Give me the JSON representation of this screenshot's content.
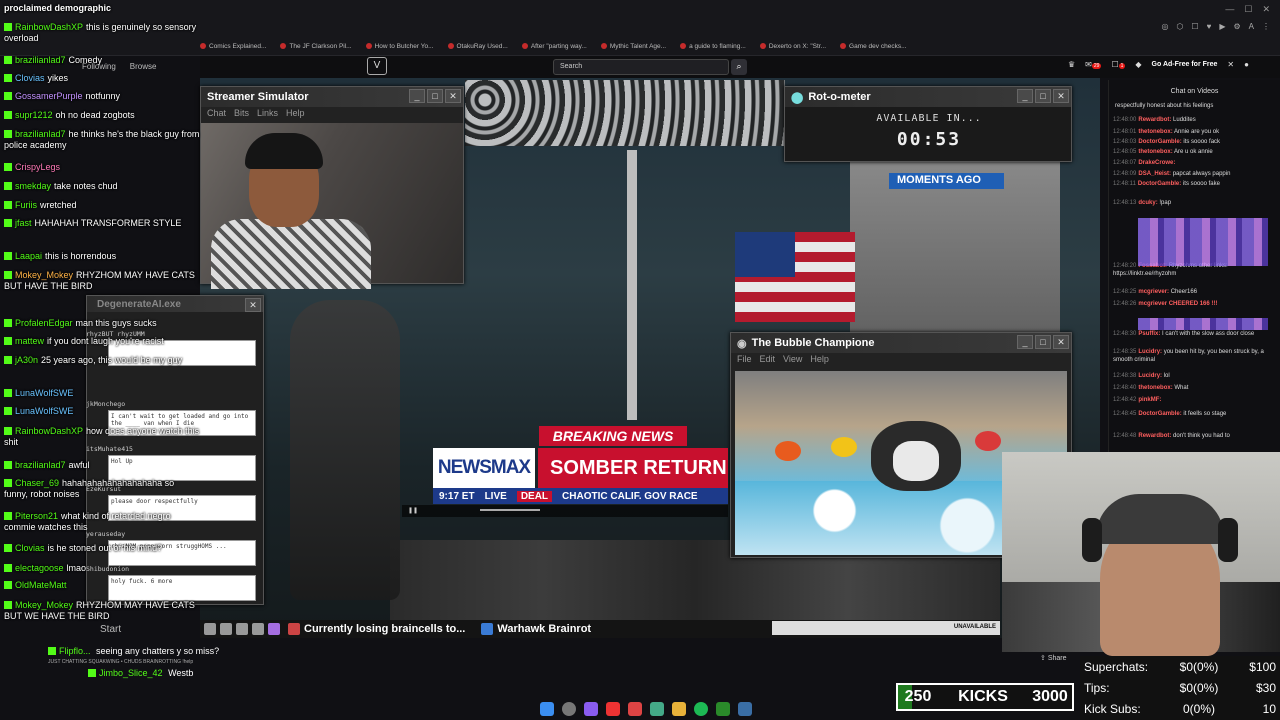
{
  "browser": {
    "bookmarks": [
      "Comics Explained...",
      "The JF Clarkson Pil...",
      "How to Butcher Yo...",
      "OtakuRay Used...",
      "After \"parting way...",
      "Mythic Talent Age...",
      "a guide to flaming...",
      "Dexerto on X: \"Str...",
      "Game dev checks..."
    ],
    "search_placeholder": "Search",
    "go_adfree": "Go Ad-Free for Free",
    "notif_count": "29",
    "mail_count": "1"
  },
  "windows": {
    "streamer_sim": {
      "title": "Streamer Simulator",
      "menu": [
        "Chat",
        "Bits",
        "Links",
        "Help"
      ],
      "following": "Following",
      "browse": "Browse"
    },
    "degenerate": {
      "title": "DegenerateAI.exe",
      "entries": [
        {
          "user": "rhyzBUT rhyzUMM",
          "text": ""
        },
        {
          "user": "jkMonchego",
          "text": "I can't wait to get loaded and go into the ____ van when I die"
        },
        {
          "user": "itsMuhate415",
          "text": "Hol Up"
        },
        {
          "user": "EzeKursut",
          "text": "please door respectfully"
        },
        {
          "user": "yerauseday",
          "text": "rhyzNOM poppacorn struggHOMS ..."
        },
        {
          "user": "Shibudonion",
          "text": "holy fuck. 6 more"
        }
      ]
    },
    "rot": {
      "title": "Rot-o-meter",
      "available": "AVAILABLE IN...",
      "time": "00:53"
    },
    "bubble": {
      "title": "The Bubble Champione",
      "menu": [
        "File",
        "Edit",
        "View",
        "Help"
      ]
    }
  },
  "moments_ago": "MOMENTS AGO",
  "news": {
    "breaking": "BREAKING NEWS",
    "logo": "NEWSMAX",
    "headline": "SOMBER RETURN F",
    "time": "9:17 ET",
    "live": "LIVE",
    "deal": "DEAL",
    "ticker": "CHAOTIC CALIF. GOV RACE"
  },
  "taskbar": {
    "start": "Start",
    "items": [
      "Currently losing braincells to...",
      "Warhawk Brainrot"
    ],
    "unavailable": "UNAVAILABLE"
  },
  "chat_left": [
    {
      "user": "",
      "text": "proclaimed demographic"
    },
    {
      "user": "RainbowDashXP",
      "text": "this is genuinely so sensory overload"
    },
    {
      "user": "brazilianlad7",
      "text": "Comedy"
    },
    {
      "user": "Clovias",
      "text": "yikes"
    },
    {
      "user": "GossamerPurple",
      "text": "notfunny"
    },
    {
      "user": "supr1212",
      "text": "oh no dead zogbots"
    },
    {
      "user": "brazilianlad7",
      "text": "he thinks he's the black guy from police academy"
    },
    {
      "user": "CrispyLegs",
      "text": ""
    },
    {
      "user": "smekday",
      "text": "take notes chud"
    },
    {
      "user": "Furiis",
      "text": "wretched"
    },
    {
      "user": "jfast",
      "text": "HAHAHAH TRANSFORMER STYLE"
    },
    {
      "user": "Laapai",
      "text": "this is horrendous"
    },
    {
      "user": "Mokey_Mokey",
      "text": "RHYZHOM MAY HAVE CATS BUT HAVE THE BIRD"
    },
    {
      "user": "ProfalenEdgar",
      "text": "man this guys sucks"
    },
    {
      "user": "mattew",
      "text": "if you dont laugh you're racist"
    },
    {
      "user": "jA30n",
      "text": "25 years ago, this would be my guy"
    },
    {
      "user": "LunaWolfSWE",
      "text": ""
    },
    {
      "user": "LunaWolfSWE",
      "text": ""
    },
    {
      "user": "RainbowDashXP",
      "text": "how does anyone watch this shit"
    },
    {
      "user": "brazilianlad7",
      "text": "awful"
    },
    {
      "user": "Chaser_69",
      "text": "hahahahahahahahahaha so funny, robot noises"
    },
    {
      "user": "Piterson21",
      "text": "what kind of retarded negro commie watches this"
    },
    {
      "user": "Clovias",
      "text": "is he stoned out of his mind?"
    },
    {
      "user": "electagoose",
      "text": "lmao"
    },
    {
      "user": "OldMateMatt",
      "text": ""
    },
    {
      "user": "Mokey_Mokey",
      "text": "RHYZHOM MAY HAVE CATS BUT WE HAVE THE BIRD"
    }
  ],
  "chat_bottom": [
    {
      "user": "Flipflo...",
      "text": "seeing any chatters y so miss?"
    },
    {
      "user": "Jimbo_Slice_42",
      "text": "Westb"
    }
  ],
  "chat_bottom_tiny": "JUST CHATTING SQUAKWING • CHUDS BRAINROTTING !help",
  "chat_right": {
    "header": "Chat on Videos",
    "messages": [
      {
        "ts": "",
        "user": "",
        "text": "respectfully honest about his feelings"
      },
      {
        "ts": "12:48:00",
        "user": "Rewardbot:",
        "text": "Luddites"
      },
      {
        "ts": "12:48:01",
        "user": "thetonebox:",
        "text": "Annie are you ok"
      },
      {
        "ts": "12:48:03",
        "user": "DoctorGamble:",
        "text": "its soooo fack"
      },
      {
        "ts": "12:48:05",
        "user": "thetonebox:",
        "text": "Are u ok annie"
      },
      {
        "ts": "12:48:07",
        "user": "DrakeCrowe:",
        "text": ""
      },
      {
        "ts": "12:48:09",
        "user": "DSA_Heist:",
        "text": "papcat always pappin"
      },
      {
        "ts": "12:48:11",
        "user": "DoctorGamble:",
        "text": "its soooo fake"
      },
      {
        "ts": "12:48:13",
        "user": "dcuky:",
        "text": "!pap"
      },
      {
        "ts": "12:48:20",
        "user": "Fossabot:",
        "text": "Rhyzohms other links: https://linktr.ee/rhyzohm"
      },
      {
        "ts": "12:48:25",
        "user": "mcgriever:",
        "text": "Cheer166"
      },
      {
        "ts": "12:48:26",
        "user": "mcgriever CHEERED 166 !!!",
        "text": ""
      },
      {
        "ts": "12:48:30",
        "user": "Psuffix:",
        "text": "I can't with the slow ass door close"
      },
      {
        "ts": "12:48:35",
        "user": "Lucidry:",
        "text": "you been hit by, you been struck by, a smooth criminal"
      },
      {
        "ts": "12:48:38",
        "user": "Lucidry:",
        "text": "lol"
      },
      {
        "ts": "12:48:40",
        "user": "thetonebox:",
        "text": "What"
      },
      {
        "ts": "12:48:42",
        "user": "pinkMF:",
        "text": ""
      },
      {
        "ts": "12:48:45",
        "user": "DoctorGamble:",
        "text": "it feells so stage"
      },
      {
        "ts": "12:48:48",
        "user": "Rewardbot:",
        "text": "don't think you had to"
      }
    ]
  },
  "webcam": {
    "share": "Share"
  },
  "stats": {
    "rows": [
      {
        "label": "Superchats:",
        "mid": "$0(0%)",
        "end": "$100"
      },
      {
        "label": "Tips:",
        "mid": "$0(0%)",
        "end": "$30"
      },
      {
        "label": "Kick Subs:",
        "mid": "0(0%)",
        "end": "10"
      }
    ],
    "kicks_current": "250",
    "kicks_label": "KICKS",
    "kicks_goal": "3000",
    "kicks_progress": 0.083
  },
  "colors": {
    "kick_green": "#53fc18",
    "newsmax_red": "#c8102e",
    "newsmax_blue": "#1d3a8a",
    "moments_blue": "#1f5fb5"
  }
}
